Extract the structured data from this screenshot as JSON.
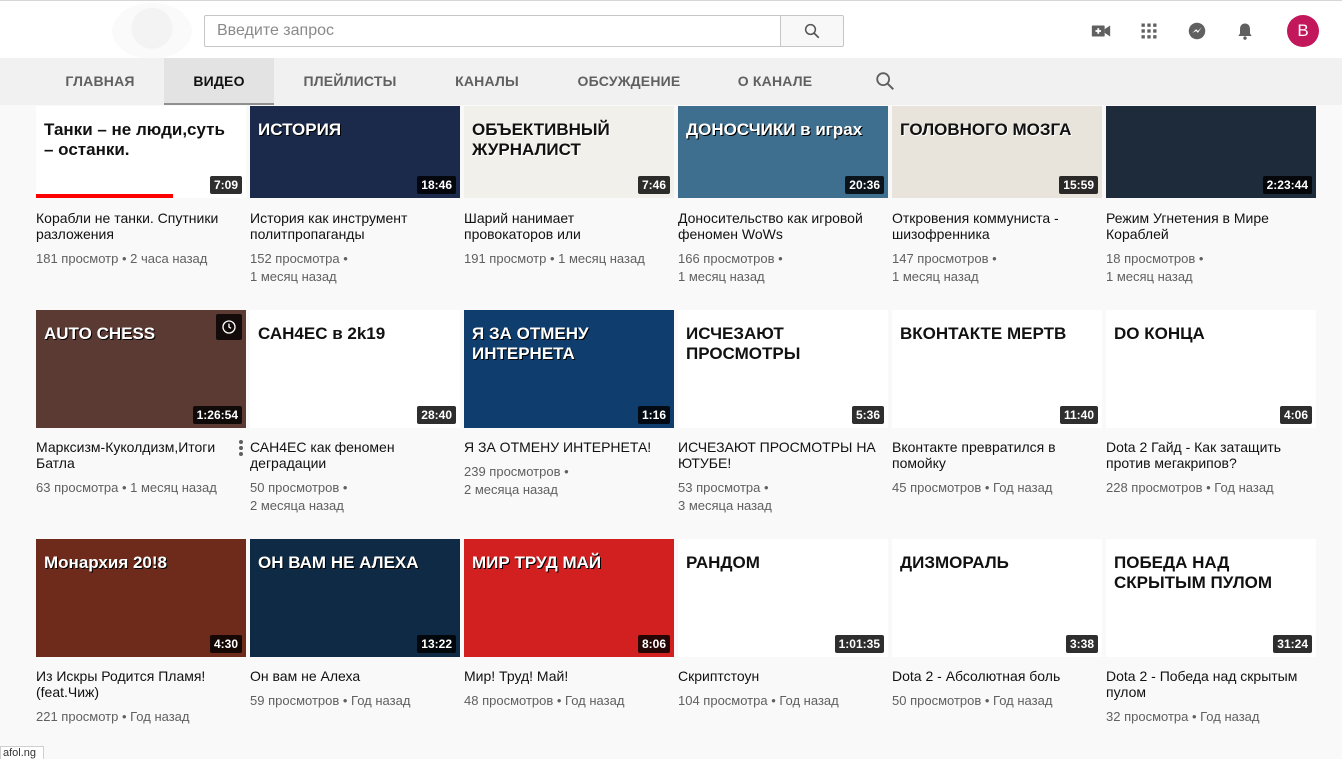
{
  "search": {
    "placeholder": "Введите запрос"
  },
  "user": {
    "initial": "B"
  },
  "tabs": [
    {
      "label": "ГЛАВНАЯ",
      "active": false
    },
    {
      "label": "ВИДЕО",
      "active": true
    },
    {
      "label": "ПЛЕЙЛИСТЫ",
      "active": false
    },
    {
      "label": "КАНАЛЫ",
      "active": false
    },
    {
      "label": "ОБСУЖДЕНИЕ",
      "active": false
    },
    {
      "label": "О КАНАЛЕ",
      "active": false
    }
  ],
  "videos": [
    {
      "title": "Корабли не танки. Спутники разложения",
      "meta1": "181 просмотр • 2 часа назад",
      "meta2": "",
      "duration": "7:09",
      "thumb_text": "Танки – не люди,суть – останки.",
      "watched_fraction": 0.65,
      "bg": "#ffffff"
    },
    {
      "title": "История как инструмент политпропаганды",
      "meta1": "152 просмотра •",
      "meta2": "1 месяц назад",
      "duration": "18:46",
      "thumb_text": "ИСТОРИЯ",
      "bg": "#1b2a4a"
    },
    {
      "title": "Шарий нанимает провокаторов или",
      "meta1": "191 просмотр • 1 месяц назад",
      "meta2": "",
      "duration": "7:46",
      "thumb_text": "ОБЪЕКТИВНЫЙ ЖУРНАЛИСТ",
      "bg": "#f2f0ea"
    },
    {
      "title": "Доносительство как игровой феномен WoWs",
      "meta1": "166 просмотров •",
      "meta2": "1 месяц назад",
      "duration": "20:36",
      "thumb_text": "ДОНОСЧИКИ в играх",
      "bg": "#3e6f8e"
    },
    {
      "title": "Откровения коммуниста - шизофренника",
      "meta1": "147 просмотров •",
      "meta2": "1 месяц назад",
      "duration": "15:59",
      "thumb_text": "ГОЛОВНОГО МОЗГА",
      "bg": "#e8e4dc"
    },
    {
      "title": "Режим Угнетения в Мире Кораблей",
      "meta1": "18 просмотров •",
      "meta2": "1 месяц назад",
      "duration": "2:23:44",
      "thumb_text": "",
      "bg": "#1d2b3a"
    },
    {
      "title": "Марксизм-Куколдизм,Итоги Батла",
      "meta1": "63 просмотра • 1 месяц назад",
      "meta2": "",
      "duration": "1:26:54",
      "thumb_text": "AUTO CHESS",
      "bg": "#5a3a33"
    },
    {
      "title": "САН4ЕС как феномен деградации",
      "meta1": "50 просмотров •",
      "meta2": "2 месяца назад",
      "duration": "28:40",
      "thumb_text": "САН4ЕС в 2k19",
      "bg": "#ffffff"
    },
    {
      "title": "Я ЗА ОТМЕНУ ИНТЕРНЕТА!",
      "meta1": "239 просмотров •",
      "meta2": "2 месяца назад",
      "duration": "1:16",
      "thumb_text": "Я ЗА ОТМЕНУ ИНТЕРНЕТА",
      "bg": "#0e3d6e"
    },
    {
      "title": "ИСЧЕЗАЮТ ПРОСМОТРЫ НА ЮТУБЕ!",
      "meta1": "53 просмотра •",
      "meta2": "3 месяца назад",
      "duration": "5:36",
      "thumb_text": "ИСЧЕЗАЮТ ПРОСМОТРЫ",
      "bg": "#ffffff"
    },
    {
      "title": "Вконтакте превратился в помойку",
      "meta1": "45 просмотров • Год назад",
      "meta2": "",
      "duration": "11:40",
      "thumb_text": "ВКОНТАКТЕ МЕРТВ",
      "bg": "#ffffff"
    },
    {
      "title": "Dota 2 Гайд - Как затащить против мегакрипов?",
      "meta1": "228 просмотров • Год назад",
      "meta2": "",
      "duration": "4:06",
      "thumb_text": "DO КОНЦА",
      "bg": "#ffffff"
    },
    {
      "title": "Из Искры Родится Пламя! (feat.Чиж)",
      "meta1": "221 просмотр • Год назад",
      "meta2": "",
      "duration": "4:30",
      "thumb_text": "Монархия 20!8",
      "bg": "#6e2a1a"
    },
    {
      "title": "Он вам не Алеха",
      "meta1": "59 просмотров • Год назад",
      "meta2": "",
      "duration": "13:22",
      "thumb_text": "ОН ВАМ НЕ АЛЕХА",
      "bg": "#0f2a44"
    },
    {
      "title": "Мир! Труд! Май!",
      "meta1": "48 просмотров • Год назад",
      "meta2": "",
      "duration": "8:06",
      "thumb_text": "МИР ТРУД МАЙ",
      "bg": "#d21f1f"
    },
    {
      "title": "Скриптстоун",
      "meta1": "104 просмотра • Год назад",
      "meta2": "",
      "duration": "1:01:35",
      "thumb_text": "РАНДОМ",
      "bg": "#ffffff"
    },
    {
      "title": "Dota 2 - Абсолютная боль",
      "meta1": "50 просмотров • Год назад",
      "meta2": "",
      "duration": "3:38",
      "thumb_text": "ДИЗМОРАЛЬ",
      "bg": "#ffffff"
    },
    {
      "title": "Dota 2 - Победа над скрытым пулом",
      "meta1": "32 просмотра • Год назад",
      "meta2": "",
      "duration": "31:24",
      "thumb_text": "ПОБЕДА НАД СКРЫТЫМ ПУЛОМ",
      "bg": "#ffffff"
    }
  ],
  "statusbar": {
    "text": "afol.ng"
  }
}
